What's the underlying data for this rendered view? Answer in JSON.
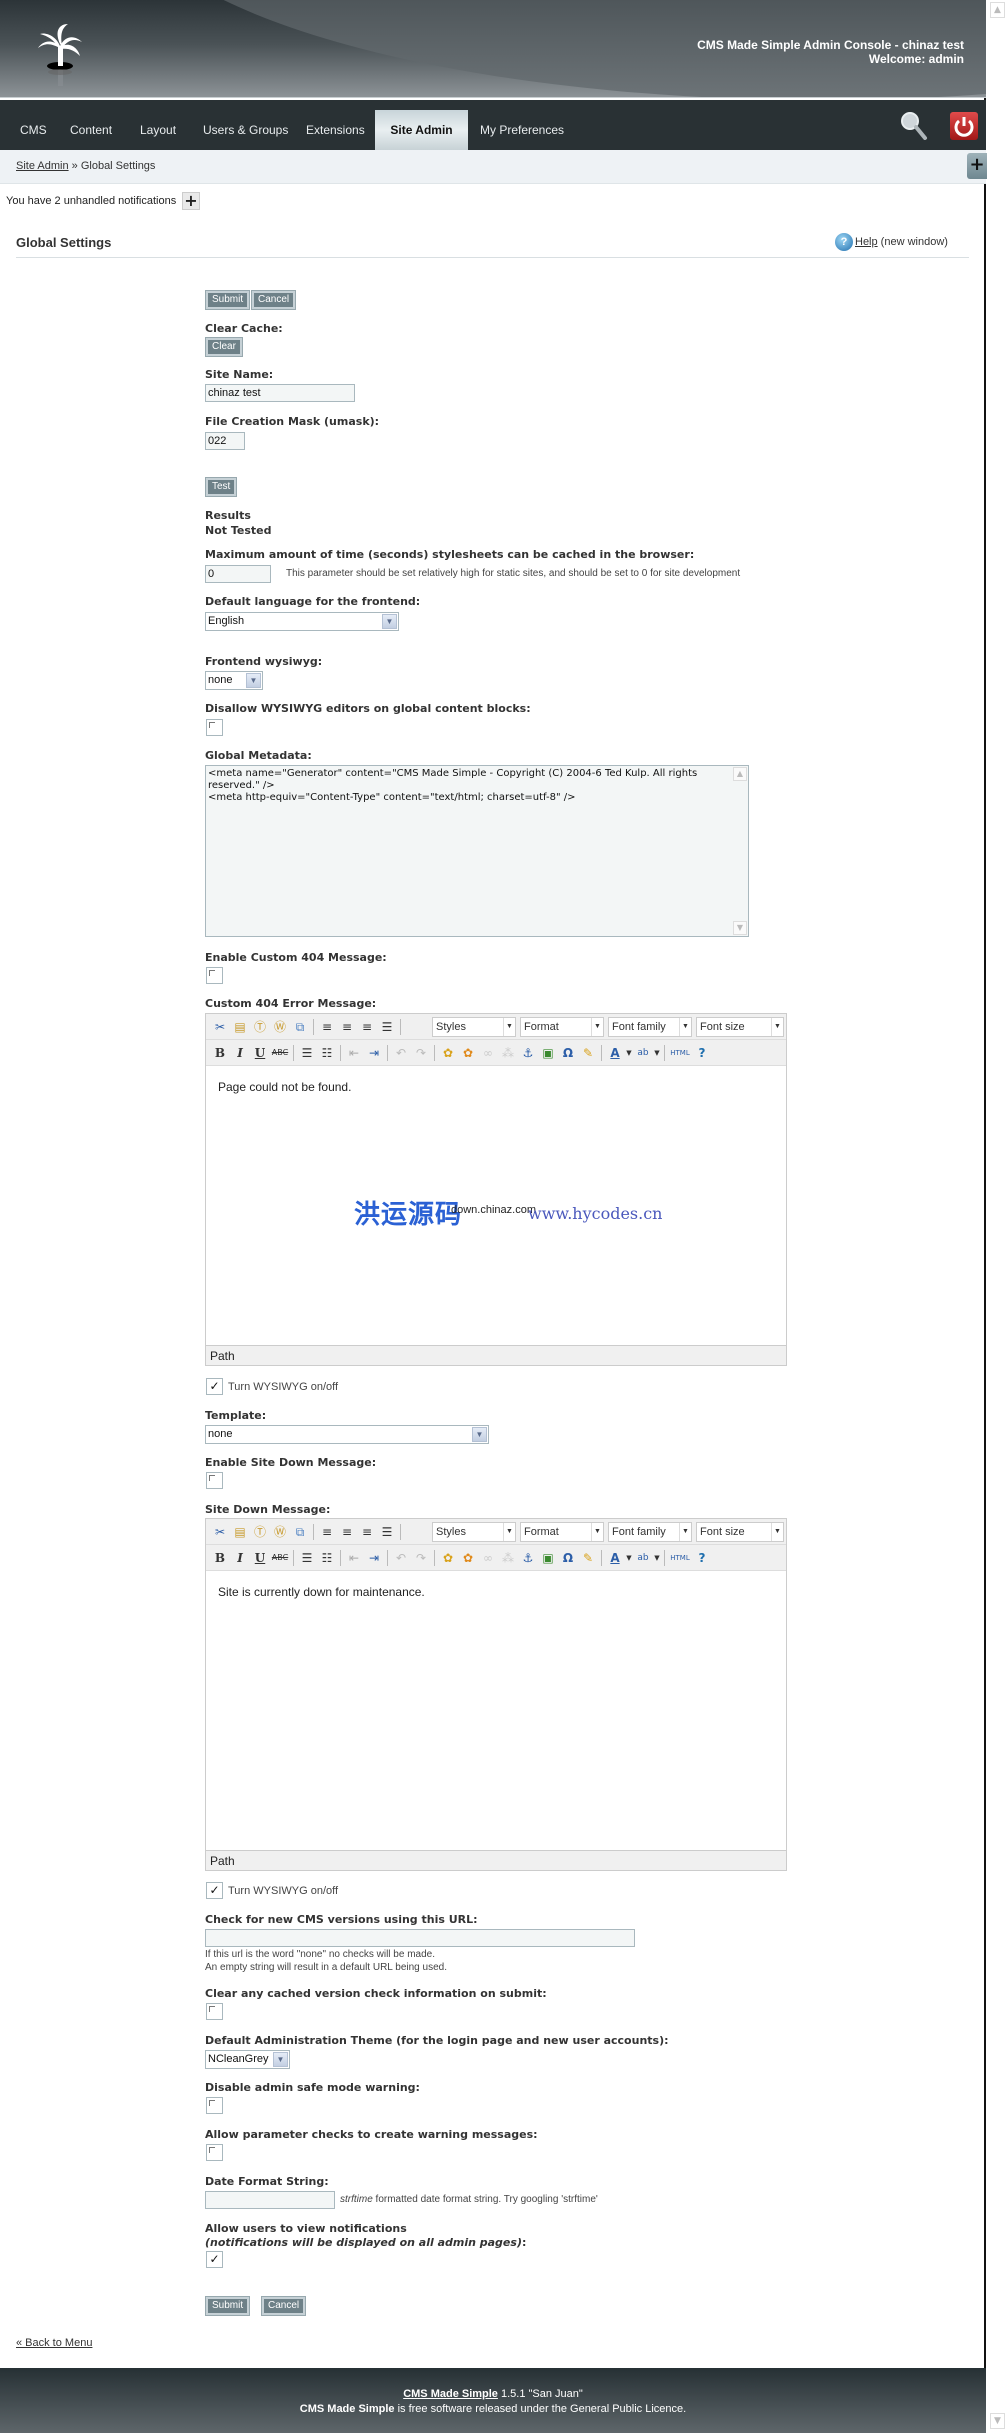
{
  "header": {
    "title": "CMS Made Simple Admin Console - chinaz test",
    "welcome": "Welcome: admin"
  },
  "nav": {
    "items": [
      {
        "label": "CMS"
      },
      {
        "label": "Content"
      },
      {
        "label": "Layout"
      },
      {
        "label": "Users & Groups"
      },
      {
        "label": "Extensions"
      },
      {
        "label": "Site Admin",
        "active": true
      },
      {
        "label": "My Preferences"
      }
    ]
  },
  "breadcrumb": {
    "parent": "Site Admin",
    "separator": " » ",
    "current": "Global Settings"
  },
  "notifications": {
    "text": "You have 2 unhandled notifications",
    "toggle": "+"
  },
  "page": {
    "title": "Global Settings",
    "help_link": "Help",
    "help_suffix": " (new window)"
  },
  "buttons": {
    "submit": "Submit",
    "cancel": "Cancel",
    "clear": "Clear",
    "test": "Test"
  },
  "form": {
    "clear_cache_label": "Clear Cache:",
    "site_name_label": "Site Name:",
    "site_name_value": "chinaz test",
    "umask_label": "File Creation Mask (umask):",
    "umask_value": "022",
    "results_label": "Results",
    "results_value": "Not Tested",
    "css_cache_label": "Maximum amount of time (seconds) stylesheets can be cached in the browser:",
    "css_cache_value": "0",
    "css_cache_hint": "This parameter should be set relatively high for static sites, and should be set to 0 for site development",
    "frontend_lang_label": "Default language for the frontend:",
    "frontend_lang_value": "English",
    "frontend_wysiwyg_label": "Frontend wysiwyg:",
    "frontend_wysiwyg_value": "none",
    "disallow_wysiwyg_label": "Disallow WYSIWYG editors on global content blocks:",
    "disallow_wysiwyg_checked": false,
    "metadata_label": "Global Metadata:",
    "metadata_value": "<meta name=\"Generator\" content=\"CMS Made Simple - Copyright (C) 2004-6 Ted Kulp. All rights reserved.\" />\n<meta http-equiv=\"Content-Type\" content=\"text/html; charset=utf-8\" />",
    "enable_404_label": "Enable Custom 404 Message:",
    "enable_404_checked": false,
    "custom_404_label": "Custom 404 Error Message:",
    "custom_404_content": "Page could not be found.",
    "wysiwyg_toggle_label": "Turn WYSIWYG on/off",
    "template_label": "Template:",
    "template_value": "none",
    "enable_sitedown_label": "Enable Site Down Message:",
    "enable_sitedown_checked": false,
    "sitedown_label": "Site Down Message:",
    "sitedown_content": "Site is currently down for maintenance.",
    "version_url_label": "Check for new CMS versions using this URL:",
    "version_url_value": "",
    "version_url_hint1": "If this url is the word \"none\" no checks will be made.",
    "version_url_hint2": "An empty string will result in a default URL being used.",
    "clear_version_label": "Clear any cached version check information on submit:",
    "admin_theme_label": "Default Administration Theme (for the login page and new user accounts):",
    "admin_theme_value": "NCleanGrey",
    "safe_mode_label": "Disable admin safe mode warning:",
    "param_checks_label": "Allow parameter checks to create warning messages:",
    "date_format_label": "Date Format String:",
    "date_format_value": "",
    "date_format_hint_em": "strftime",
    "date_format_hint": " formatted date format string.  Try googling 'strftime'",
    "notifications_label": "Allow users to view notifications",
    "notifications_sublabel": "(notifications will be displayed on all admin pages)",
    "notifications_colon": ":",
    "notifications_checked": true
  },
  "editor": {
    "dropdowns": [
      "Styles",
      "Format",
      "Font family",
      "Font size"
    ],
    "path_label": "Path",
    "toolbar1": [
      "cut-icon",
      "paste-icon",
      "paste-text-icon",
      "paste-word-icon",
      "copy-icon",
      "align-left-icon",
      "align-center-icon",
      "align-right-icon",
      "align-justify-icon"
    ],
    "toolbar2": [
      "bold-icon",
      "italic-icon",
      "underline-icon",
      "strikethrough-icon",
      "bullet-list-icon",
      "numbered-list-icon",
      "outdent-icon",
      "indent-icon",
      "undo-icon",
      "redo-icon",
      "cms-link-icon",
      "module-link-icon",
      "link-icon",
      "unlink-icon",
      "anchor-icon",
      "image-icon",
      "special-char-icon",
      "cleanup-icon",
      "text-color-icon",
      "highlight-color-icon",
      "html-source-icon",
      "help-icon"
    ]
  },
  "watermark": {
    "cn": "洪运源码",
    "site": "down.chinaz.com",
    "url": "www.hycodes.cn"
  },
  "back_link": "« Back to Menu",
  "footer": {
    "brand": "CMS Made Simple",
    "version": " 1.5.1 \"San Juan\"",
    "license_brand": "CMS Made Simple",
    "license_text": " is free software released under the General Public Licence."
  }
}
